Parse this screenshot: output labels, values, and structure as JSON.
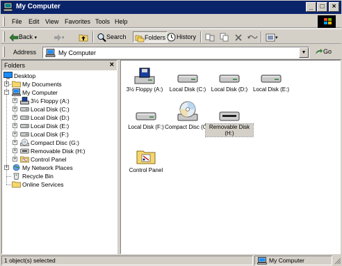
{
  "window": {
    "title": "My Computer",
    "controls": [
      "_",
      "□",
      "×"
    ]
  },
  "menu": [
    {
      "label": "File"
    },
    {
      "label": "Edit"
    },
    {
      "label": "View"
    },
    {
      "label": "Favorites"
    },
    {
      "label": "Tools"
    },
    {
      "label": "Help"
    }
  ],
  "toolbar": {
    "back": "Back",
    "search": "Search",
    "folders": "Folders",
    "history": "History"
  },
  "address": {
    "label": "Address",
    "value": "My Computer",
    "go": "Go"
  },
  "folders_pane": {
    "title": "Folders",
    "close": "×",
    "tree": [
      {
        "label": "Desktop",
        "icon": "desktop-icon"
      },
      {
        "label": "My Documents",
        "icon": "folder-icon"
      },
      {
        "label": "My Computer",
        "icon": "computer-icon"
      },
      {
        "label": "3½ Floppy (A:)",
        "icon": "floppy-icon"
      },
      {
        "label": "Local Disk (C:)",
        "icon": "disk-icon"
      },
      {
        "label": "Local Disk (D:)",
        "icon": "disk-icon"
      },
      {
        "label": "Local Disk (E:)",
        "icon": "disk-icon"
      },
      {
        "label": "Local Disk (F:)",
        "icon": "disk-icon"
      },
      {
        "label": "Compact Disc (G:)",
        "icon": "cd-icon"
      },
      {
        "label": "Removable Disk (H:)",
        "icon": "removable-disk-icon"
      },
      {
        "label": "Control Panel",
        "icon": "control-panel-icon"
      },
      {
        "label": "My Network Places",
        "icon": "network-icon"
      },
      {
        "label": "Recycle Bin",
        "icon": "recycle-bin-icon"
      },
      {
        "label": "Online Services",
        "icon": "folder-icon"
      }
    ]
  },
  "items": [
    {
      "label": "3½ Floppy (A:)",
      "icon": "floppy-icon"
    },
    {
      "label": "Local Disk (C:)",
      "icon": "disk-icon"
    },
    {
      "label": "Local Disk (D:)",
      "icon": "disk-icon"
    },
    {
      "label": "Local Disk (E:)",
      "icon": "disk-icon"
    },
    {
      "label": "Local Disk (F:)",
      "icon": "disk-icon"
    },
    {
      "label": "Compact Disc (G:)",
      "icon": "cd-icon"
    },
    {
      "label": "Removable Disk (H:)",
      "icon": "removable-disk-icon",
      "selected": true
    },
    {
      "label": "Control Panel",
      "icon": "control-panel-icon"
    }
  ],
  "status": {
    "left": "1 object(s) selected",
    "right": "My Computer"
  },
  "colors": {
    "title_bar": "#0a246a",
    "face": "#d4d0c8",
    "selection": "#d4d0c8"
  }
}
